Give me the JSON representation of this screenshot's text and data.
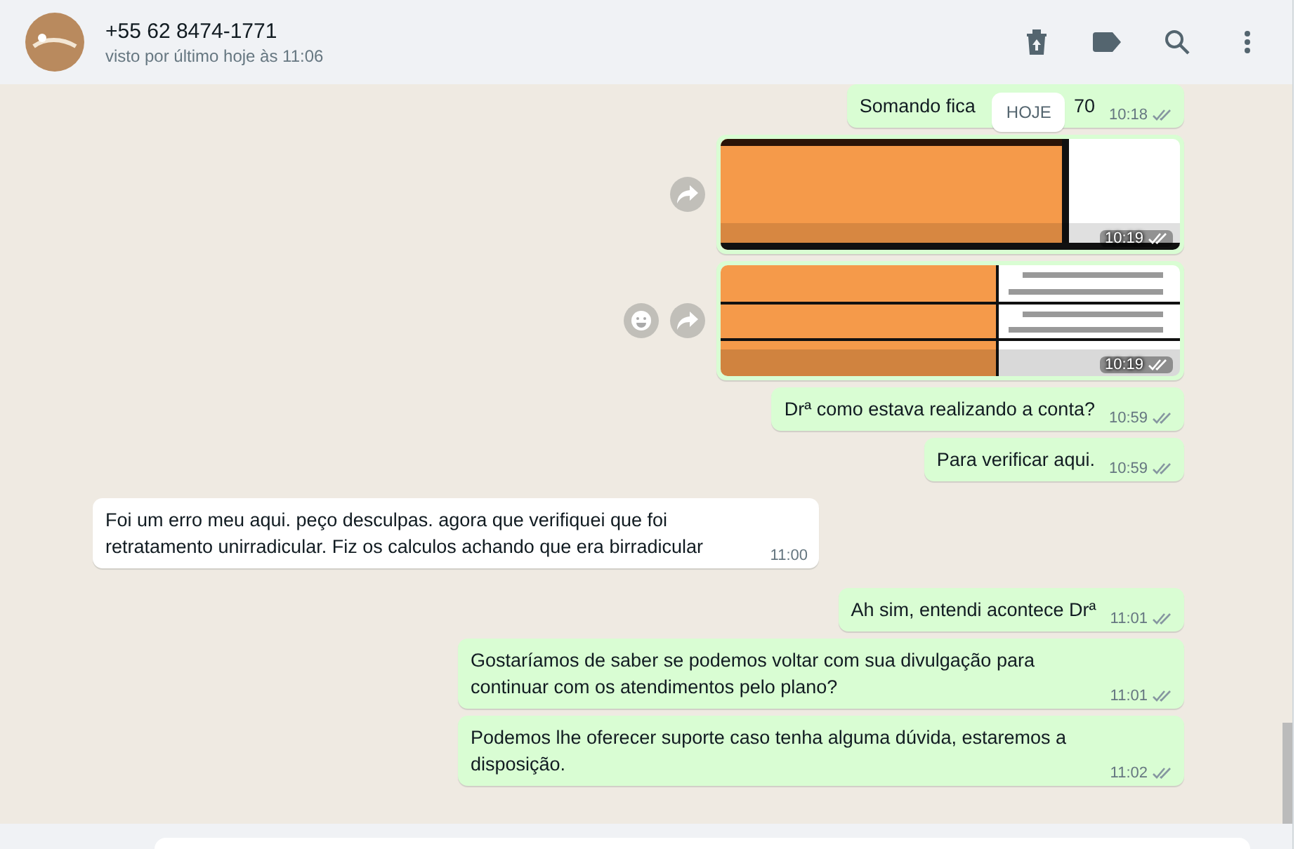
{
  "header": {
    "name": "+55 62 8474-1771",
    "status": "visto por último hoje às 11:06"
  },
  "date_badge": "HOJE",
  "messages": [
    {
      "kind": "text",
      "outgoing": true,
      "text": "Somando fica",
      "text_after_badge": "70",
      "time": "10:18",
      "delivered": true
    },
    {
      "outgoing": true,
      "time": "10:19",
      "delivered": true,
      "emoji_button": false
    },
    {
      "outgoing": true,
      "time": "10:19",
      "delivered": true,
      "emoji_button": true
    },
    {
      "kind": "text",
      "outgoing": true,
      "text": "Drª como estava realizando a conta?",
      "time": "10:59",
      "delivered": true
    },
    {
      "kind": "text",
      "outgoing": true,
      "text": "Para verificar aqui.",
      "time": "10:59",
      "delivered": true
    },
    {
      "kind": "text",
      "outgoing": false,
      "text": "Foi um erro meu aqui. peço desculpas. agora que verifiquei que foi retratamento unirradicular. Fiz os calculos achando que era birradicular",
      "time": "11:00"
    },
    {
      "kind": "text",
      "outgoing": true,
      "text": "Ah sim, entendi acontece Drª",
      "time": "11:01",
      "delivered": true
    },
    {
      "kind": "text",
      "outgoing": true,
      "text": "Gostaríamos de saber se podemos voltar com sua divulgação para continuar com os atendimentos pelo plano?",
      "time": "11:01",
      "delivered": true
    },
    {
      "kind": "text",
      "outgoing": true,
      "text": "Podemos lhe oferecer suporte caso tenha alguma dúvida, estaremos a disposição.",
      "time": "11:02",
      "delivered": true
    }
  ]
}
